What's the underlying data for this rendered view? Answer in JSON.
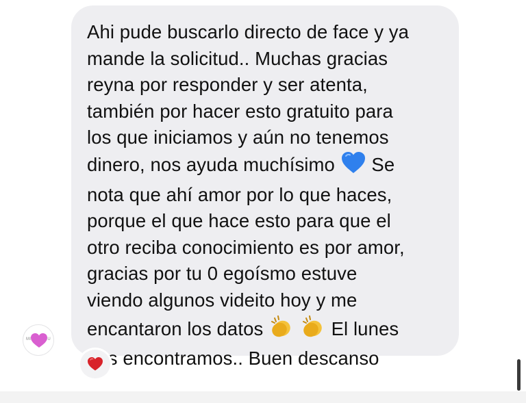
{
  "conversation": {
    "message": {
      "lines": [
        "Ahi pude buscarlo directo de face y ya",
        "mande la solicitud.. Muchas gracias",
        "reyna por responder y ser atenta,",
        "también por hacer esto gratuito para",
        "los que iniciamos y aún no tenemos",
        "dinero, nos ayuda muchísimo",
        " Se",
        "nota que ahí amor por lo que haces,",
        "porque el que hace esto para que el",
        "otro reciba conocimiento es por amor,",
        "gracias por tu 0 egoísmo  estuve",
        "viendo algunos videito hoy y me",
        "encantaron los datos",
        " El lunes",
        "nos encontramos.. Buen descanso"
      ],
      "inline_emojis": [
        "blue-heart",
        "clapping-hands",
        "clapping-hands"
      ],
      "bubble_color": "#eeeef1",
      "text_color": "#111111"
    },
    "avatar": {
      "label": "MIRESHA.U",
      "heart_color": "#d95fd0"
    },
    "reaction": {
      "emoji": "red-heart",
      "color": "#d8232a"
    }
  },
  "colors": {
    "background": "#ffffff",
    "bubble": "#eeeef1",
    "blue_heart": "#2f80ed",
    "clap": "#f4c23b"
  }
}
